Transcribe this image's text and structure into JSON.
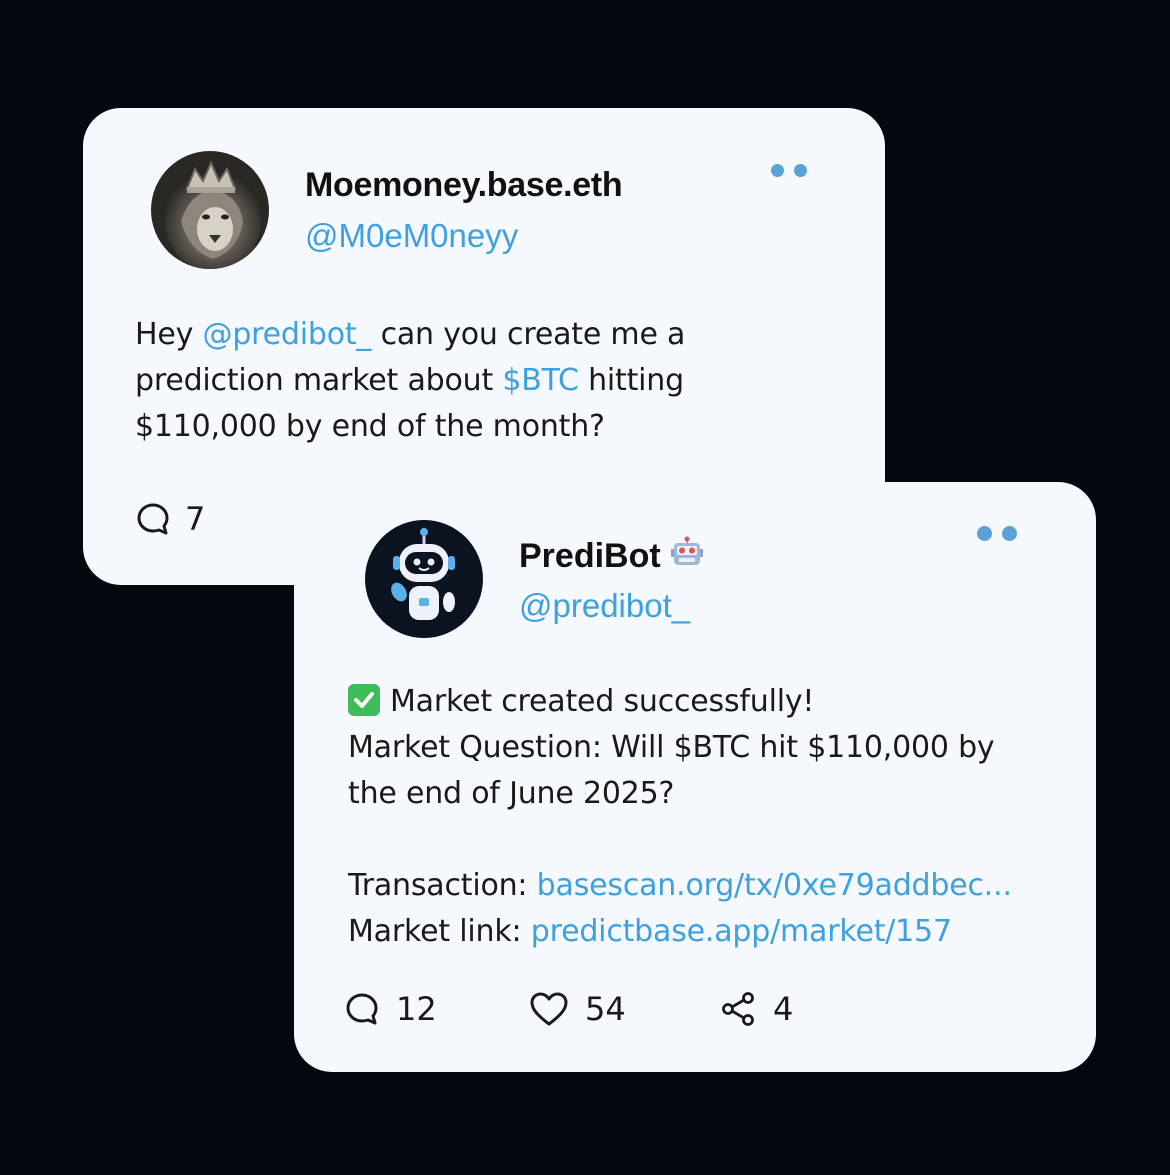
{
  "post1": {
    "display_name": "Moemoney.base.eth",
    "handle": "@M0eM0neyy",
    "avatar_icon": "lion-with-crown-avatar",
    "text": {
      "l1_a": "Hey ",
      "l1_mention": "@predibot_",
      "l1_b": " can you create me a",
      "l2_a": "prediction market about ",
      "l2_ticker": "$BTC",
      "l2_b": " hitting",
      "l3": "$110,000 by end of the month?"
    },
    "replies": "7"
  },
  "post2": {
    "display_name": "PrediBot",
    "name_emoji_icon": "robot-emoji-icon",
    "handle": "@predibot_",
    "avatar_icon": "robot-avatar",
    "text": {
      "status": "Market created successfully!",
      "q1": "Market Question: Will $BTC hit $110,000 by",
      "q2": "the end of June 2025?",
      "tx_label": "Transaction: ",
      "tx_link": "basescan.org/tx/0xe79addbec...",
      "market_label": "Market link: ",
      "market_link": "predictbase.app/market/157"
    },
    "replies": "12",
    "likes": "54",
    "shares": "4"
  },
  "colors": {
    "background": "#05070f",
    "card": "#f5f8fc",
    "link": "#3ea0e0",
    "dots": "#5aa2d6",
    "check": "#3cbc5a"
  }
}
